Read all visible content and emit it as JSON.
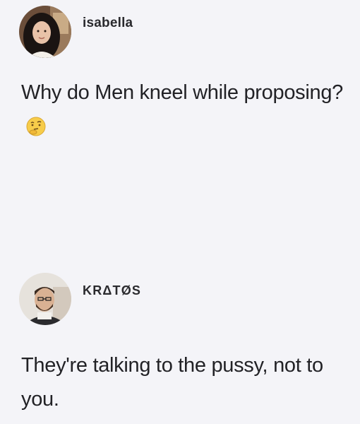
{
  "posts": [
    {
      "username": "isabella",
      "message": "Why do Men kneel while proposing?",
      "emoji": "thinking-face-icon"
    },
    {
      "username": "KRΔTØS",
      "message": "They're talking to the pussy, not to you."
    }
  ]
}
